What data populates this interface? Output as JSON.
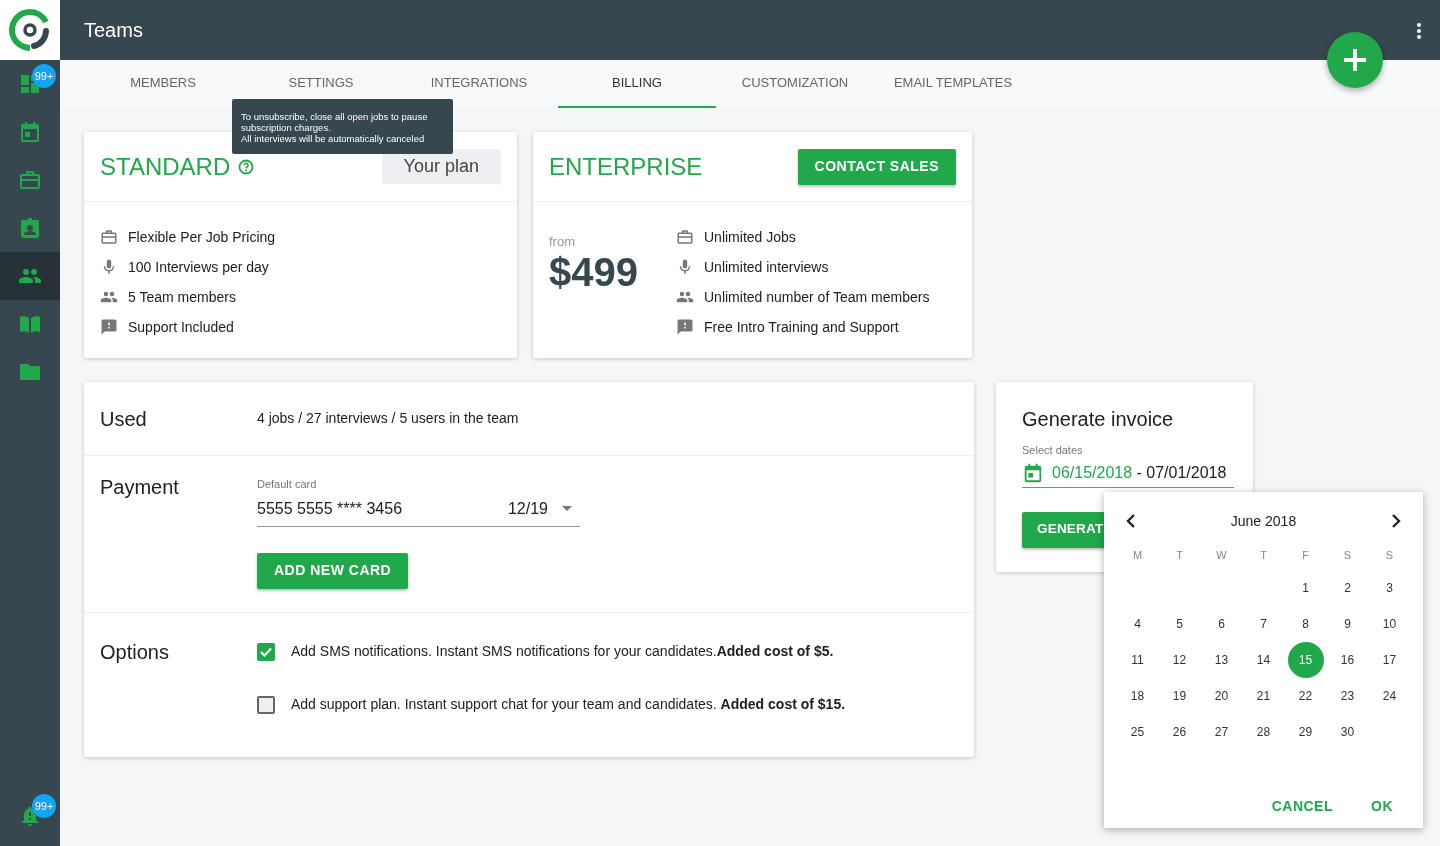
{
  "app": {
    "title": "Teams"
  },
  "sidebar": {
    "items": [
      {
        "kind": "dashboard",
        "badge": "99+",
        "selected": false
      },
      {
        "kind": "calendar",
        "selected": false
      },
      {
        "kind": "briefcase",
        "selected": false
      },
      {
        "kind": "idcard",
        "selected": false
      },
      {
        "kind": "people",
        "selected": true
      },
      {
        "kind": "book",
        "selected": false
      },
      {
        "kind": "folder",
        "selected": false
      }
    ],
    "notifications": {
      "badge": "99+"
    }
  },
  "tabs": [
    {
      "label": "MEMBERS",
      "selected": false
    },
    {
      "label": "SETTINGS",
      "selected": false
    },
    {
      "label": "INTEGRATIONS",
      "selected": false
    },
    {
      "label": "BILLING",
      "selected": true
    },
    {
      "label": "CUSTOMIZATION",
      "selected": false
    },
    {
      "label": "EMAIL TEMPLATES",
      "selected": false
    }
  ],
  "tooltip": {
    "lines": [
      "To unsubscribe, close all open jobs to pause subscription charges.",
      "All interviews will be automatically canceled"
    ]
  },
  "plans": [
    {
      "kind": "standard",
      "name": "STANDARD",
      "badge": "Your plan",
      "features": [
        {
          "kind": "jobs",
          "text": "Flexible Per Job Pricing"
        },
        {
          "kind": "mic",
          "text": "100 Interviews per day"
        },
        {
          "kind": "people",
          "text": "5 Team members"
        },
        {
          "kind": "support",
          "text": "Support Included"
        }
      ]
    },
    {
      "kind": "enterprise",
      "name": "ENTERPRISE",
      "action": "CONTACT SALES",
      "price_prefix": "from",
      "price": "$499",
      "features": [
        {
          "kind": "jobs",
          "text": "Unlimited Jobs"
        },
        {
          "kind": "mic",
          "text": "Unlimited interviews"
        },
        {
          "kind": "people",
          "text": "Unlimited number of Team members"
        },
        {
          "kind": "support",
          "text": "Free Intro Training and Support"
        }
      ]
    }
  ],
  "usage": {
    "label": "Used",
    "text": "4 jobs / 27 interviews / 5 users in the team"
  },
  "payment": {
    "label": "Payment",
    "card_label": "Default card",
    "card_number": "5555 5555 **** 3456",
    "expiry": "12/19",
    "button": "ADD NEW CARD"
  },
  "options": {
    "label": "Options",
    "items": [
      {
        "text": "Add SMS notifications. Instant SMS notifications for your candidates.**Added cost of $5.**",
        "checked": true
      },
      {
        "text": "Add support plan. Instant support chat for your team and candidates. **Added cost of $15.**",
        "checked": false
      }
    ]
  },
  "invoice": {
    "title": "Generate invoice",
    "field_label": "Select dates",
    "start": "06/15/2018",
    "separator": "-",
    "end": "07/01/2018",
    "button": "GENERAT"
  },
  "datepicker": {
    "month": "June 2018",
    "weekdays": [
      "M",
      "T",
      "W",
      "T",
      "F",
      "S",
      "S"
    ],
    "weeks": [
      {
        "kind": "leading",
        "days": [
          {
            "label": "1",
            "selected": false
          },
          {
            "label": "2",
            "selected": false
          },
          {
            "label": "3",
            "selected": false
          }
        ]
      },
      {
        "kind": "full",
        "days": [
          {
            "label": "4",
            "selected": false
          },
          {
            "label": "5",
            "selected": false
          },
          {
            "label": "6",
            "selected": false
          },
          {
            "label": "7",
            "selected": false
          },
          {
            "label": "8",
            "selected": false
          },
          {
            "label": "9",
            "selected": false
          },
          {
            "label": "10",
            "selected": false
          }
        ]
      },
      {
        "kind": "full",
        "days": [
          {
            "label": "11",
            "selected": false
          },
          {
            "label": "12",
            "selected": false
          },
          {
            "label": "13",
            "selected": false
          },
          {
            "label": "14",
            "selected": false
          },
          {
            "label": "15",
            "selected": true
          },
          {
            "label": "16",
            "selected": false
          },
          {
            "label": "17",
            "selected": false
          }
        ]
      },
      {
        "kind": "full",
        "days": [
          {
            "label": "18",
            "selected": false
          },
          {
            "label": "19",
            "selected": false
          },
          {
            "label": "20",
            "selected": false
          },
          {
            "label": "21",
            "selected": false
          },
          {
            "label": "22",
            "selected": false
          },
          {
            "label": "23",
            "selected": false
          },
          {
            "label": "24",
            "selected": false
          }
        ]
      },
      {
        "kind": "trailing",
        "days": [
          {
            "label": "25",
            "selected": false
          },
          {
            "label": "26",
            "selected": false
          },
          {
            "label": "27",
            "selected": false
          },
          {
            "label": "28",
            "selected": false
          },
          {
            "label": "29",
            "selected": false
          },
          {
            "label": "30",
            "selected": false
          }
        ]
      }
    ],
    "buttons": [
      "CANCEL",
      "OK"
    ]
  }
}
